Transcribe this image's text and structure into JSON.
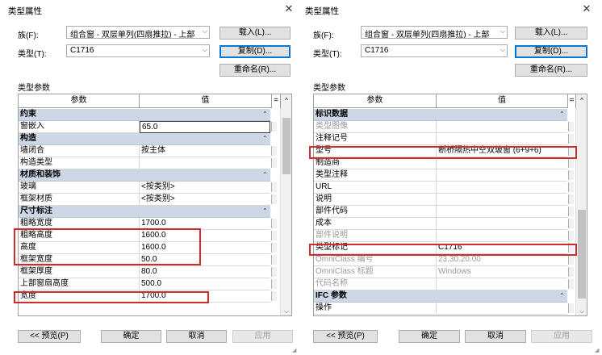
{
  "left": {
    "title": "类型属性",
    "family_label": "族(F):",
    "family_value": "组合窗 - 双层单列(四扇推拉) - 上部",
    "type_label": "类型(T):",
    "type_value": "C1716",
    "load_btn": "载入(L)...",
    "duplicate_btn": "复制(D)...",
    "rename_btn": "重命名(R)...",
    "type_params_label": "类型参数",
    "col_param": "参数",
    "col_value": "值",
    "eq": "=",
    "rows": [
      {
        "kind": "group",
        "name": "约束"
      },
      {
        "kind": "param",
        "name": "窗嵌入",
        "value": "65.0",
        "selected": true
      },
      {
        "kind": "group",
        "name": "构造"
      },
      {
        "kind": "param",
        "name": "墙闭合",
        "value": "按主体"
      },
      {
        "kind": "param",
        "name": "构造类型",
        "value": ""
      },
      {
        "kind": "group",
        "name": "材质和装饰"
      },
      {
        "kind": "param",
        "name": "玻璃",
        "value": "<按类别>"
      },
      {
        "kind": "param",
        "name": "框架材质",
        "value": "<按类别>"
      },
      {
        "kind": "group",
        "name": "尺寸标注"
      },
      {
        "kind": "param",
        "name": "粗略宽度",
        "value": "1700.0"
      },
      {
        "kind": "param",
        "name": "粗略高度",
        "value": "1600.0"
      },
      {
        "kind": "param",
        "name": "高度",
        "value": "1600.0"
      },
      {
        "kind": "param",
        "name": "框架宽度",
        "value": "50.0"
      },
      {
        "kind": "param",
        "name": "框架厚度",
        "value": "80.0"
      },
      {
        "kind": "param",
        "name": "上部窗扇高度",
        "value": "500.0"
      },
      {
        "kind": "param",
        "name": "宽度",
        "value": "1700.0"
      }
    ],
    "preview_btn": "<< 预览(P)",
    "ok_btn": "确定",
    "cancel_btn": "取消",
    "apply_btn": "应用"
  },
  "right": {
    "title": "类型属性",
    "family_label": "族(F):",
    "family_value": "组合窗 - 双层单列(四扇推拉) - 上部",
    "type_label": "类型(T):",
    "type_value": "C1716",
    "load_btn": "载入(L)...",
    "duplicate_btn": "复制(D)...",
    "rename_btn": "重命名(R)...",
    "type_params_label": "类型参数",
    "col_param": "参数",
    "col_value": "值",
    "eq": "=",
    "rows": [
      {
        "kind": "group",
        "name": "标识数据"
      },
      {
        "kind": "param",
        "name": "类型图像",
        "value": "",
        "dim": true
      },
      {
        "kind": "param",
        "name": "注释记号",
        "value": ""
      },
      {
        "kind": "param",
        "name": "型号",
        "value": "断桥隔热中空双玻窗 (6+9+6)"
      },
      {
        "kind": "param",
        "name": "制造商",
        "value": ""
      },
      {
        "kind": "param",
        "name": "类型注释",
        "value": ""
      },
      {
        "kind": "param",
        "name": "URL",
        "value": ""
      },
      {
        "kind": "param",
        "name": "说明",
        "value": ""
      },
      {
        "kind": "param",
        "name": "部件代码",
        "value": ""
      },
      {
        "kind": "param",
        "name": "成本",
        "value": ""
      },
      {
        "kind": "param",
        "name": "部件说明",
        "value": "",
        "dim": true
      },
      {
        "kind": "param",
        "name": "类型标记",
        "value": "C1716"
      },
      {
        "kind": "param",
        "name": "OmniClass 编号",
        "value": "23.30.20.00",
        "dim": true
      },
      {
        "kind": "param",
        "name": "OmniClass 标题",
        "value": "Windows",
        "dim": true
      },
      {
        "kind": "param",
        "name": "代码名称",
        "value": "",
        "dim": true
      },
      {
        "kind": "group",
        "name": "IFC 参数"
      },
      {
        "kind": "param",
        "name": "操作",
        "value": ""
      }
    ],
    "preview_btn": "<< 预览(P)",
    "ok_btn": "确定",
    "cancel_btn": "取消",
    "apply_btn": "应用"
  },
  "icons": {
    "close": "close-icon",
    "dropdown": "chevron-down-icon",
    "collapse": "double-chevron-up-icon"
  },
  "colors": {
    "group_header": "#cdd8e6",
    "highlight": "#d22b2b",
    "focus": "#0078d7"
  }
}
